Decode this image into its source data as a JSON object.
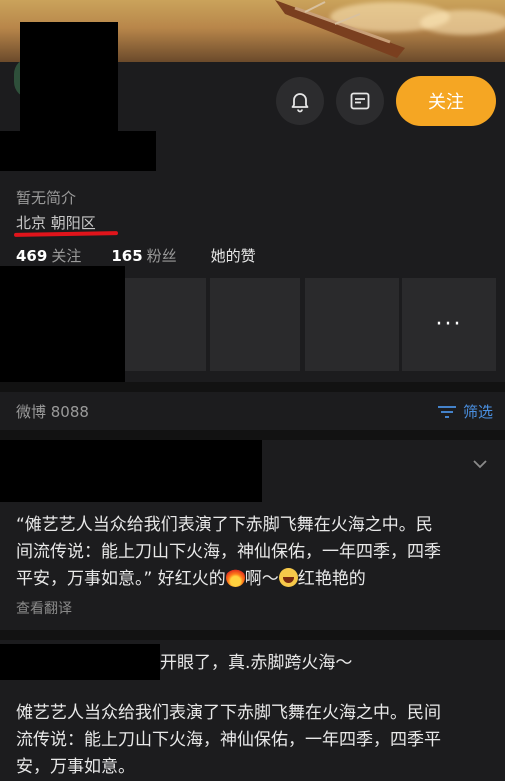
{
  "header": {
    "follow_label": "关注"
  },
  "profile": {
    "bio": "暂无简介",
    "location": "北京 朝阳区",
    "following_count": "469",
    "following_label": "关注",
    "followers_count": "165",
    "followers_label": "粉丝",
    "likes_label": "她的赞"
  },
  "tiles": {
    "more_label": "···"
  },
  "feed": {
    "weibo_label": "微博 8088",
    "filter_label": "筛选"
  },
  "post1": {
    "text_line1": "“傩艺艺人当众给我们表演了下赤脚飞舞在火海之中。民",
    "text_line2": "间流传说：能上刀山下火海，神仙保佑，一年四季，四季",
    "text_line3_a": "平安，万事如意。” 好红火的",
    "text_line3_b": "啊～",
    "text_line3_c": "红艳艳的",
    "translate_label": "查看翻译"
  },
  "post2": {
    "headline_tail": "开眼了，真.赤脚跨火海～",
    "text_line1": "傩艺艺人当众给我们表演了下赤脚飞舞在火海之中。民间",
    "text_line2": "流传说：能上刀山下火海，神仙保佑，一年四季，四季平",
    "text_line3": "安，万事如意。"
  },
  "colors": {
    "accent": "#f5a623",
    "link": "#4a90e2",
    "underline": "#e0141b",
    "background": "#1c1c1e"
  },
  "icons": {
    "bell": "bell-icon",
    "message": "message-icon",
    "filter": "filter-icon",
    "chevron": "chevron-down-icon",
    "more": "more-icon",
    "fire": "fire-emoji",
    "laugh": "laugh-emoji"
  }
}
